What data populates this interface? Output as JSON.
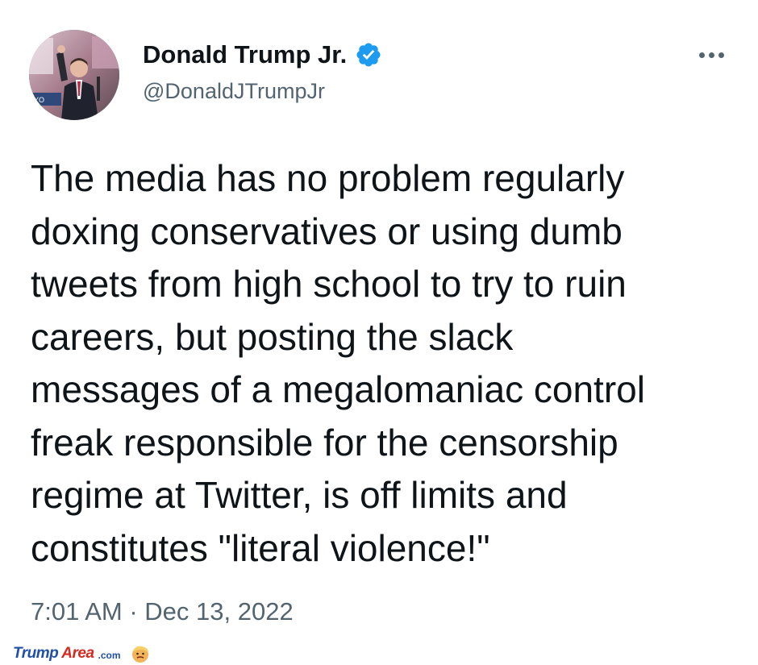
{
  "tweet": {
    "author": {
      "display_name": "Donald Trump Jr.",
      "handle": "@DonaldJTrumpJr",
      "verified": true,
      "avatar_icon": "profile-photo"
    },
    "more_icon": "more-horizontal-icon",
    "text": "The media has no problem regularly\ndoxing conservatives or using dumb\ntweets from high school to try to ruin\ncareers, but posting the slack\nmessages of a megalomaniac control\nfreak responsible for the censorship\nregime at Twitter, is off limits and\nconstitutes \"literal violence!\"",
    "timestamp": "7:01 AM · Dec 13, 2022"
  },
  "watermark": {
    "part1": "Trump",
    "part2": "Area",
    "suffix": ".com"
  },
  "colors": {
    "text_primary": "#0f1419",
    "text_secondary": "#536471",
    "verified_blue": "#1d9bf0",
    "watermark_blue": "#1f4fa8",
    "watermark_red": "#d42a22"
  }
}
